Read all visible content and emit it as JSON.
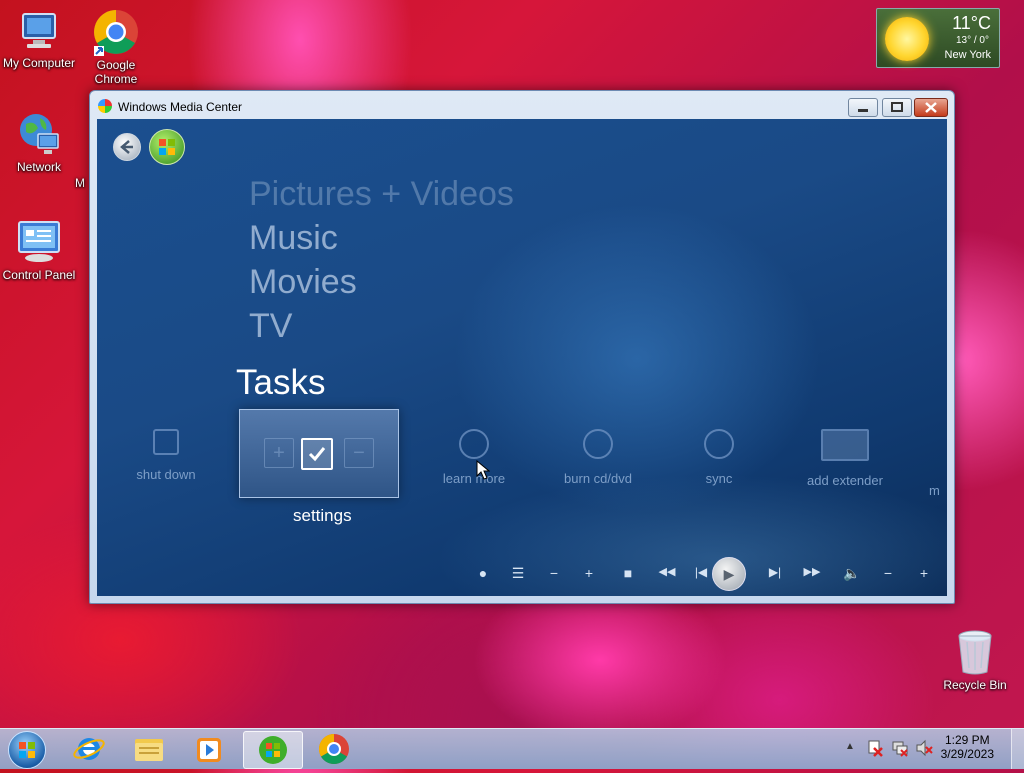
{
  "desktop": {
    "icons": [
      {
        "label": "My Computer"
      },
      {
        "label": "Google Chrome"
      },
      {
        "label": "Network"
      },
      {
        "label": "Control Panel"
      },
      {
        "label": "Recycle Bin"
      }
    ],
    "partial_label": "M"
  },
  "weather": {
    "temperature": "11°C",
    "range": "13° / 0°",
    "city": "New York",
    "icon": "sun-icon"
  },
  "window": {
    "title": "Windows Media Center",
    "menu": {
      "items": [
        "Pictures + Videos",
        "Music",
        "Movies",
        "TV"
      ],
      "current_section": "Tasks"
    },
    "tasks": [
      {
        "label": "shut down",
        "icon": "power-icon"
      },
      {
        "label": "settings",
        "icon": "checkmark-icon"
      },
      {
        "label": "learn more",
        "icon": "windows-logo-icon"
      },
      {
        "label": "burn cd/dvd",
        "icon": "disc-icon"
      },
      {
        "label": "sync",
        "icon": "sync-icon"
      },
      {
        "label": "add extender",
        "icon": "monitor-icon"
      },
      {
        "label": "m",
        "icon": ""
      }
    ],
    "transport": {
      "record": "●",
      "guide": "☰",
      "ch_minus": "−",
      "ch_plus": "+",
      "stop": "■",
      "rewind": "◀◀",
      "prev": "|◀",
      "play": "▶",
      "next": "▶|",
      "ffwd": "▶▶",
      "mute": "🔈",
      "vol_minus": "−",
      "vol_plus": "+"
    }
  },
  "taskbar": {
    "clock": {
      "time": "1:29 PM",
      "date": "3/29/2023"
    },
    "tray_arrow": "▲"
  },
  "colors": {
    "wmc_blue": "#1a4a86",
    "menu_text": "#b9cde6",
    "task_text": "#7d9ec7"
  }
}
